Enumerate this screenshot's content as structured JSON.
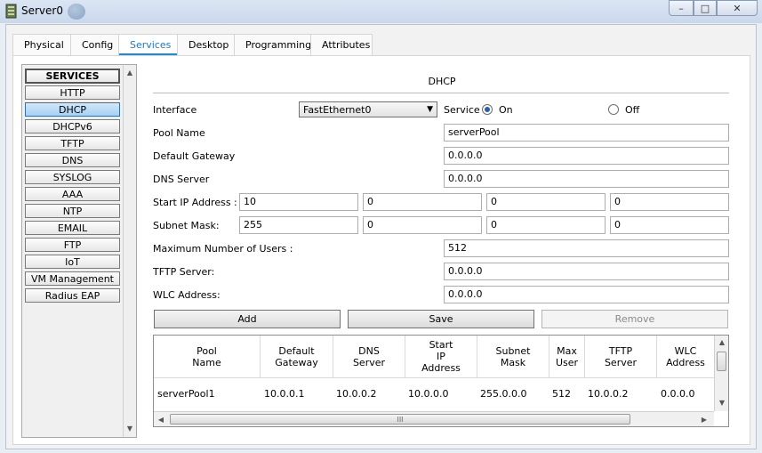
{
  "window": {
    "title": "Server0",
    "min_glyph": "–",
    "max_glyph": "□",
    "close_glyph": "✕"
  },
  "tabs": [
    {
      "label": "Physical"
    },
    {
      "label": "Config"
    },
    {
      "label": "Services",
      "active": true
    },
    {
      "label": "Desktop"
    },
    {
      "label": "Programming"
    },
    {
      "label": "Attributes"
    }
  ],
  "services": {
    "header": "SERVICES",
    "items": [
      "HTTP",
      "DHCP",
      "DHCPv6",
      "TFTP",
      "DNS",
      "SYSLOG",
      "AAA",
      "NTP",
      "EMAIL",
      "FTP",
      "IoT",
      "VM Management",
      "Radius EAP"
    ],
    "selected": "DHCP"
  },
  "dhcp": {
    "title": "DHCP",
    "interface_label": "Interface",
    "interface_value": "FastEthernet0",
    "service_label": "Service",
    "on_label": "On",
    "off_label": "Off",
    "pool_name_label": "Pool Name",
    "pool_name_value": "serverPool",
    "default_gateway_label": "Default Gateway",
    "default_gateway_value": "0.0.0.0",
    "dns_server_label": "DNS Server",
    "dns_server_value": "0.0.0.0",
    "start_ip_label": "Start IP Address :",
    "start_ip": [
      "10",
      "0",
      "0",
      "0"
    ],
    "subnet_mask_label": "Subnet Mask:",
    "subnet_mask": [
      "255",
      "0",
      "0",
      "0"
    ],
    "max_users_label": "Maximum Number of Users :",
    "max_users_value": "512",
    "tftp_label": "TFTP Server:",
    "tftp_value": "0.0.0.0",
    "wlc_label": "WLC Address:",
    "wlc_value": "0.0.0.0",
    "add_label": "Add",
    "save_label": "Save",
    "remove_label": "Remove"
  },
  "pool_table": {
    "columns": [
      "Pool\nName",
      "Default\nGateway",
      "DNS\nServer",
      "Start\nIP\nAddress",
      "Subnet\nMask",
      "Max\nUser",
      "TFTP\nServer",
      "WLC\nAddress"
    ],
    "rows": [
      [
        "serverPool1",
        "10.0.0.1",
        "10.0.0.2",
        "10.0.0.0",
        "255.0.0.0",
        "512",
        "10.0.0.2",
        "0.0.0.0"
      ]
    ],
    "scroll_grip": "III"
  }
}
